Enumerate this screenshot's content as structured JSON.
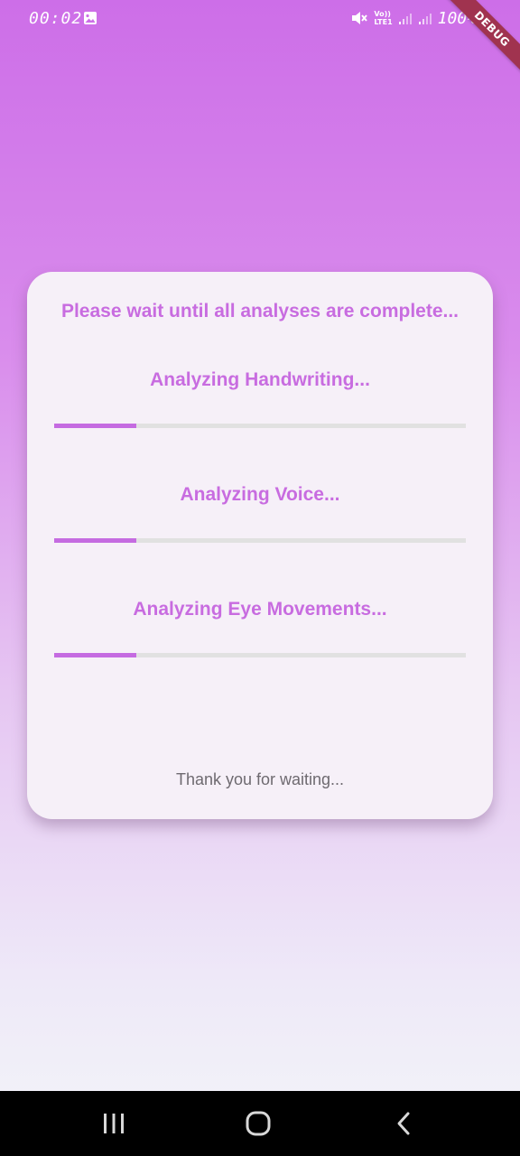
{
  "status_bar": {
    "time": "00:02",
    "volte_top": "Vo))",
    "volte_bottom": "LTE1",
    "battery": "100%"
  },
  "debug_banner": "DEBUG",
  "card": {
    "title": "Please wait until all analyses are complete...",
    "tasks": [
      {
        "label": "Analyzing Handwriting...",
        "progress": 0.2
      },
      {
        "label": "Analyzing Voice...",
        "progress": 0.2
      },
      {
        "label": "Analyzing Eye Movements...",
        "progress": 0.2
      }
    ],
    "footer": "Thank you for waiting..."
  },
  "colors": {
    "accent": "#c86ce0",
    "progress_fill": "#c56be1",
    "progress_track": "#e1e1e1",
    "card_bg": "#f6f0f8",
    "debug_ribbon": "#a0334f"
  },
  "nav_bar": {
    "icons": [
      "recent-apps-icon",
      "home-icon",
      "back-icon"
    ]
  }
}
